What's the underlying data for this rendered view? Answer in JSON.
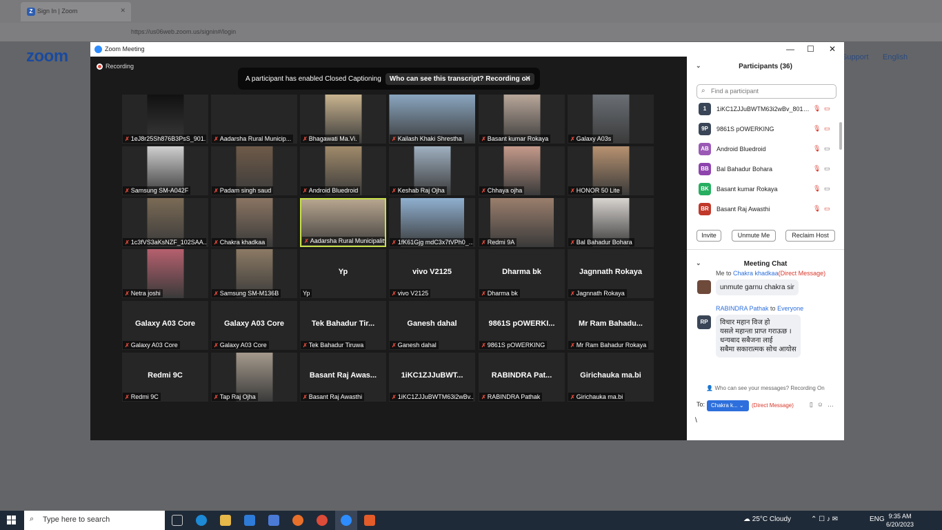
{
  "browser": {
    "tab_title": "Sign In | Zoom",
    "url": "https://us06web.zoom.us/signin#/login"
  },
  "page": {
    "logo": "zoom",
    "support_link": "Support",
    "language_link": "English"
  },
  "window": {
    "title": "Zoom Meeting",
    "recording_label": "Recording",
    "cc_banner_text": "A participant has enabled Closed Captioning",
    "cc_banner_action": "Who can see this transcript? Recording on"
  },
  "tiles": [
    {
      "label": "1eJ8r25Sh876B3PsS_901...",
      "big": "",
      "video": true,
      "color": "#111"
    },
    {
      "label": "Aadarsha Rural Municip...",
      "big": "",
      "video": false,
      "color": ""
    },
    {
      "label": "Bhagawati  Ma.Vi.",
      "big": "",
      "video": true,
      "color": "#c9b48f"
    },
    {
      "label": "Kailash Khaki Shrestha",
      "big": "",
      "video": true,
      "color": "#8aa6c0"
    },
    {
      "label": "Basant kumar Rokaya",
      "big": "",
      "video": true,
      "color": "#b9a79a"
    },
    {
      "label": "Galaxy A03s",
      "big": "",
      "video": true,
      "color": "#6a6f75"
    },
    {
      "label": "Samsung SM-A042F",
      "big": "",
      "video": true,
      "color": "#cfcfcf"
    },
    {
      "label": "Padam singh saud",
      "big": "",
      "video": true,
      "color": "#6e5a48"
    },
    {
      "label": "Android Bluedroid",
      "big": "",
      "video": true,
      "color": "#a08a6a"
    },
    {
      "label": "Keshab Raj Ojha",
      "big": "",
      "video": true,
      "color": "#9fb0c0"
    },
    {
      "label": "Chhaya ojha",
      "big": "",
      "video": true,
      "color": "#c49a8a"
    },
    {
      "label": "HONOR 50 Lite",
      "big": "",
      "video": true,
      "color": "#b79270"
    },
    {
      "label": "1c3fVS3aKsNZF_102SAA...",
      "big": "",
      "video": true,
      "color": "#7a6a55"
    },
    {
      "label": "Chakra khadkaa",
      "big": "",
      "video": true,
      "color": "#8a7462"
    },
    {
      "label": "Aadarsha Rural Municipality",
      "big": "",
      "video": true,
      "color": "#b7a58e"
    },
    {
      "label": "1fK61Gjg mdC3x7tVPh0_...",
      "big": "",
      "video": true,
      "color": "#8fb0d0"
    },
    {
      "label": "Redmi 9A",
      "big": "",
      "video": true,
      "color": "#9a7e6c"
    },
    {
      "label": "Bal Bahadur Bohara",
      "big": "",
      "video": true,
      "color": "#d8d4d0"
    },
    {
      "label": "Netra joshi",
      "big": "",
      "video": true,
      "color": "#b6606e"
    },
    {
      "label": "Samsung SM-M136B",
      "big": "",
      "video": true,
      "color": "#8c7a64"
    },
    {
      "label": "Yp",
      "big": "Yp",
      "video": false,
      "color": ""
    },
    {
      "label": "vivo V2125",
      "big": "vivo V2125",
      "video": false,
      "color": ""
    },
    {
      "label": "Dharma bk",
      "big": "Dharma bk",
      "video": false,
      "color": ""
    },
    {
      "label": "Jagnnath Rokaya",
      "big": "Jagnnath Rokaya",
      "video": false,
      "color": ""
    },
    {
      "label": "Galaxy A03 Core",
      "big": "Galaxy A03 Core",
      "video": false,
      "color": ""
    },
    {
      "label": "Galaxy A03 Core",
      "big": "Galaxy A03 Core",
      "video": false,
      "color": ""
    },
    {
      "label": "Tek Bahadur Tiruwa",
      "big": "Tek Bahadur Tir...",
      "video": false,
      "color": ""
    },
    {
      "label": "Ganesh dahal",
      "big": "Ganesh dahal",
      "video": false,
      "color": ""
    },
    {
      "label": "9861S pOWERKING",
      "big": "9861S pOWERKI...",
      "video": false,
      "color": ""
    },
    {
      "label": "Mr Ram Bahadur Rokaya",
      "big": "Mr Ram Bahadu...",
      "video": false,
      "color": ""
    },
    {
      "label": "Redmi 9C",
      "big": "Redmi 9C",
      "video": false,
      "color": ""
    },
    {
      "label": "Tap Raj Ojha",
      "big": "",
      "video": true,
      "color": "#a59a8c"
    },
    {
      "label": "Basant Raj Awasthi",
      "big": "Basant Raj Awas...",
      "video": false,
      "color": ""
    },
    {
      "label": "1iKC1ZJJuBWTM63i2wBv...",
      "big": "1iKC1ZJJuBWT...",
      "video": false,
      "color": ""
    },
    {
      "label": "RABINDRA  Pathak",
      "big": "RABINDRA  Pat...",
      "video": false,
      "color": ""
    },
    {
      "label": "Girichauka ma.bi",
      "big": "Girichauka ma.bi",
      "video": false,
      "color": ""
    }
  ],
  "participants": {
    "title": "Participants (36)",
    "search_placeholder": "Find a participant",
    "list": [
      {
        "initials": "1",
        "name": "1iKC1ZJJuBWTM63i2wBv_801Sw...",
        "color": "#3a4657",
        "video_on": false
      },
      {
        "initials": "9P",
        "name": "9861S pOWERKING",
        "color": "#3a4657",
        "video_on": false
      },
      {
        "initials": "AB",
        "name": "Android Bluedroid",
        "color": "#9b59b6",
        "video_on": true
      },
      {
        "initials": "BB",
        "name": "Bal Bahadur Bohara",
        "color": "#8e44ad",
        "video_on": true
      },
      {
        "initials": "BK",
        "name": "Basant kumar Rokaya",
        "color": "#27ae60",
        "video_on": true
      },
      {
        "initials": "BR",
        "name": "Basant Raj Awasthi",
        "color": "#c0392b",
        "video_on": false
      }
    ],
    "invite_label": "Invite",
    "unmute_label": "Unmute Me",
    "reclaim_label": "Reclaim Host"
  },
  "chat": {
    "title": "Meeting Chat",
    "msg1_prefix": "Me to",
    "msg1_to": "Chakra khadkaa",
    "msg1_tag": "(Direct Message)",
    "msg1_text": "unmute garnu chakra  sir",
    "msg2_from": "RABINDRA  Pathak",
    "msg2_to_word": "to",
    "msg2_to": "Everyone",
    "msg2_initials": "RP",
    "msg2_lines": [
      "विचार महान विज हो",
      "यसले महान्ता प्राप्त गराऊछ ।",
      "धन्यबाद  सबैजना लाई",
      "सबैमा सकारात्मक सोच आयोस"
    ],
    "hint": "Who can see your messages? Recording On",
    "to_label": "To:",
    "to_recipient": "Chakra k...",
    "to_tag": "(Direct Message)",
    "input_text": "\\"
  },
  "taskbar": {
    "search_placeholder": "Type here to search",
    "weather": "25°C  Cloudy",
    "lang": "ENG",
    "time": "9:35 AM",
    "date": "6/20/2023"
  }
}
